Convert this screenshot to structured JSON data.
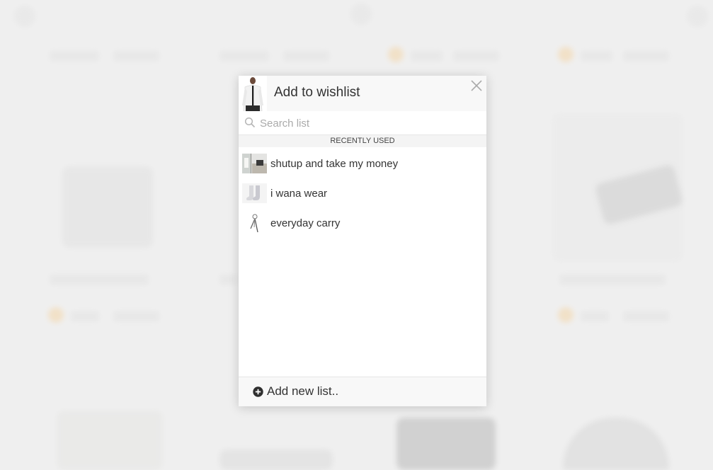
{
  "modal": {
    "title": "Add to wishlist",
    "search": {
      "placeholder": "Search list",
      "value": ""
    },
    "section_label": "RECENTLY USED",
    "lists": [
      {
        "label": "shutup and take my money",
        "thumb": "room-photo"
      },
      {
        "label": "i wana wear",
        "thumb": "socks-photo"
      },
      {
        "label": "everyday carry",
        "thumb": "keychain-photo"
      }
    ],
    "footer": {
      "add_label": "Add new list.."
    },
    "icons": {
      "close": "close-icon",
      "search": "search-icon",
      "add": "plus-circle-icon",
      "product": "product-thumbnail"
    }
  },
  "colors": {
    "header_bg": "#f8f8f8",
    "text": "#333333",
    "placeholder": "#aaaaaa",
    "backdrop": "#efefef"
  }
}
